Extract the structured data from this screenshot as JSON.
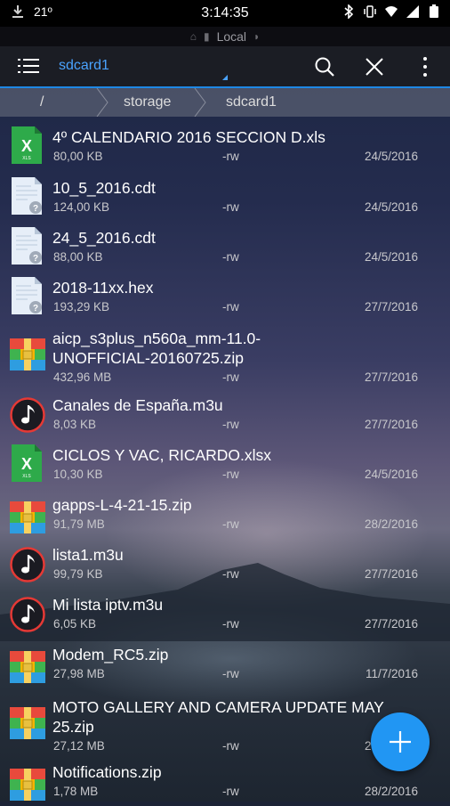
{
  "status": {
    "temperature": "21º",
    "time": "3:14:35"
  },
  "location": {
    "label": "Local"
  },
  "toolbar": {
    "title": "sdcard1",
    "icons": [
      "menu-icon",
      "search-icon",
      "close-icon",
      "more-vert-icon"
    ]
  },
  "breadcrumbs": [
    "/",
    "storage",
    "sdcard1"
  ],
  "files": [
    {
      "name": "4º CALENDARIO 2016 SECCION D.xls",
      "size": "80,00 KB",
      "perm": "-rw",
      "date": "24/5/2016",
      "icon": "spreadsheet-icon"
    },
    {
      "name": "10_5_2016.cdt",
      "size": "124,00 KB",
      "perm": "-rw",
      "date": "24/5/2016",
      "icon": "unknown-file-icon"
    },
    {
      "name": "24_5_2016.cdt",
      "size": "88,00 KB",
      "perm": "-rw",
      "date": "24/5/2016",
      "icon": "unknown-file-icon"
    },
    {
      "name": "2018-11xx.hex",
      "size": "193,29 KB",
      "perm": "-rw",
      "date": "27/7/2016",
      "icon": "unknown-file-icon"
    },
    {
      "name": "aicp_s3plus_n560a_mm-11.0-",
      "name2": "UNOFFICIAL-20160725.zip",
      "size": "432,96 MB",
      "perm": "-rw",
      "date": "27/7/2016",
      "icon": "archive-icon"
    },
    {
      "name": "Canales de España.m3u",
      "size": "8,03 KB",
      "perm": "-rw",
      "date": "27/7/2016",
      "icon": "music-icon"
    },
    {
      "name": "CICLOS Y VAC, RICARDO.xlsx",
      "size": "10,30 KB",
      "perm": "-rw",
      "date": "24/5/2016",
      "icon": "spreadsheet-icon"
    },
    {
      "name": "gapps-L-4-21-15.zip",
      "size": "91,79 MB",
      "perm": "-rw",
      "date": "28/2/2016",
      "icon": "archive-icon"
    },
    {
      "name": "lista1.m3u",
      "size": "99,79 KB",
      "perm": "-rw",
      "date": "27/7/2016",
      "icon": "music-icon"
    },
    {
      "name": "Mi lista iptv.m3u",
      "size": "6,05 KB",
      "perm": "-rw",
      "date": "27/7/2016",
      "icon": "music-icon"
    },
    {
      "name": "Modem_RC5.zip",
      "size": "27,98 MB",
      "perm": "-rw",
      "date": "11/7/2016",
      "icon": "archive-icon"
    },
    {
      "name": "MOTO GALLERY AND CAMERA UPDATE MAY",
      "name2": "25.zip",
      "size": "27,12 MB",
      "perm": "-rw",
      "date": "26/4/2016",
      "icon": "archive-icon"
    },
    {
      "name": "Notifications.zip",
      "size": "1,78 MB",
      "perm": "-rw",
      "date": "28/2/2016",
      "icon": "archive-icon"
    }
  ],
  "fab": {
    "icon": "add-icon"
  }
}
